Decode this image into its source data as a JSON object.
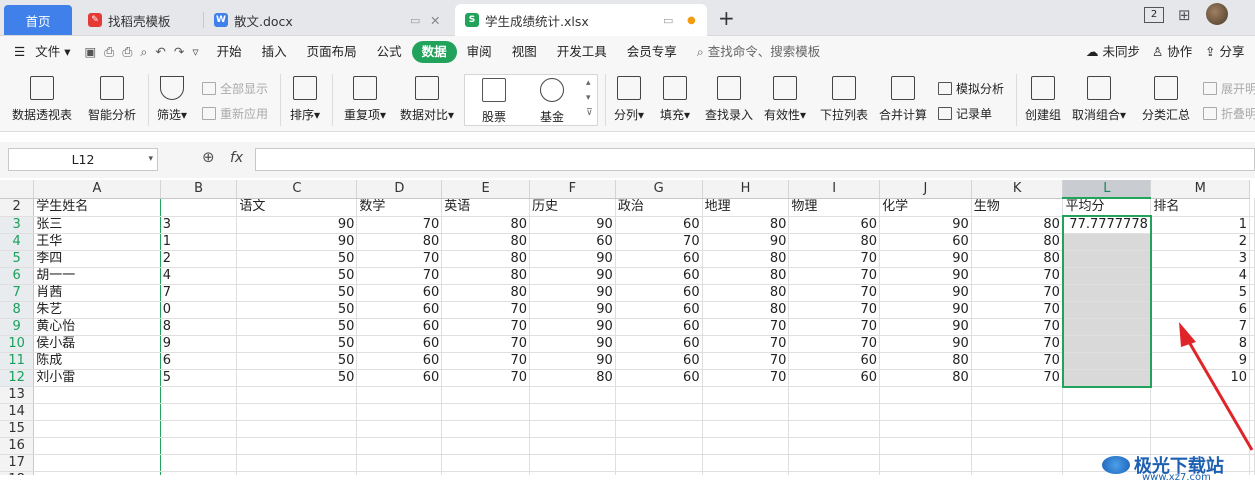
{
  "tabs": [
    {
      "label": "首页"
    },
    {
      "label": "找稻壳模板"
    },
    {
      "label": "散文.docx"
    },
    {
      "label": "学生成绩统计.xlsx"
    }
  ],
  "titlebar": {
    "new_tab": "+",
    "badge": "2"
  },
  "menu": {
    "file": "文件",
    "items": [
      "开始",
      "插入",
      "页面布局",
      "公式",
      "数据",
      "审阅",
      "视图",
      "开发工具",
      "会员专享"
    ],
    "active": "数据",
    "search": "查找命令、搜索模板",
    "sync": "未同步",
    "collab": "协作",
    "share": "分享"
  },
  "ribbon": {
    "pivot": "数据透视表",
    "smart": "智能分析",
    "filter": "筛选",
    "show_all": "全部显示",
    "reapply": "重新应用",
    "sort": "排序",
    "dup": "重复项",
    "compare": "数据对比",
    "stock": "股票",
    "fund": "基金",
    "split": "分列",
    "fill": "填充",
    "lookup": "查找录入",
    "validity": "有效性",
    "dropdown": "下拉列表",
    "consolidate": "合并计算",
    "simulate": "模拟分析",
    "record": "记录单",
    "group": "创建组",
    "ungroup": "取消组合",
    "subtotal": "分类汇总",
    "expand": "展开明",
    "collapse": "折叠明"
  },
  "formula": {
    "cell_ref": "L12",
    "fx": "fx",
    "zoom_icon": "zoom-icon",
    "value": ""
  },
  "grid": {
    "columns": [
      "A",
      "B",
      "C",
      "D",
      "E",
      "F",
      "G",
      "H",
      "I",
      "J",
      "K",
      "L",
      "M"
    ],
    "selected_column": "L",
    "rows": [
      {
        "n": "2",
        "cells": [
          "学生姓名",
          "",
          "语文",
          "数学",
          "英语",
          "历史",
          "政治",
          "地理",
          "物理",
          "化学",
          "生物",
          "平均分",
          "排名"
        ]
      },
      {
        "n": "3",
        "cells": [
          "张三",
          "3",
          "90",
          "70",
          "80",
          "90",
          "60",
          "80",
          "60",
          "90",
          "80",
          "77.7777778",
          "1"
        ]
      },
      {
        "n": "4",
        "cells": [
          "王华",
          "1",
          "90",
          "80",
          "80",
          "60",
          "70",
          "90",
          "80",
          "60",
          "80",
          "",
          "2"
        ]
      },
      {
        "n": "5",
        "cells": [
          "李四",
          "2",
          "50",
          "70",
          "80",
          "90",
          "60",
          "80",
          "70",
          "90",
          "80",
          "",
          "3"
        ]
      },
      {
        "n": "6",
        "cells": [
          "胡一一",
          "4",
          "50",
          "70",
          "80",
          "90",
          "60",
          "80",
          "70",
          "90",
          "70",
          "",
          "4"
        ]
      },
      {
        "n": "7",
        "cells": [
          "肖茜",
          "7",
          "50",
          "60",
          "80",
          "90",
          "60",
          "80",
          "70",
          "90",
          "70",
          "",
          "5"
        ]
      },
      {
        "n": "8",
        "cells": [
          "朱艺",
          "0",
          "50",
          "60",
          "70",
          "90",
          "60",
          "80",
          "70",
          "90",
          "70",
          "",
          "6"
        ]
      },
      {
        "n": "9",
        "cells": [
          "黄心怡",
          "8",
          "50",
          "60",
          "70",
          "90",
          "60",
          "70",
          "70",
          "90",
          "70",
          "",
          "7"
        ]
      },
      {
        "n": "10",
        "cells": [
          "侯小磊",
          "9",
          "50",
          "60",
          "70",
          "90",
          "60",
          "70",
          "70",
          "90",
          "70",
          "",
          "8"
        ]
      },
      {
        "n": "11",
        "cells": [
          "陈成",
          "6",
          "50",
          "60",
          "70",
          "90",
          "60",
          "70",
          "60",
          "80",
          "70",
          "",
          "9"
        ]
      },
      {
        "n": "12",
        "cells": [
          "刘小雷",
          "5",
          "50",
          "60",
          "70",
          "80",
          "60",
          "70",
          "60",
          "80",
          "70",
          "",
          "10"
        ]
      },
      {
        "n": "13",
        "cells": [
          "",
          "",
          "",
          "",
          "",
          "",
          "",
          "",
          "",
          "",
          "",
          "",
          ""
        ]
      },
      {
        "n": "14",
        "cells": [
          "",
          "",
          "",
          "",
          "",
          "",
          "",
          "",
          "",
          "",
          "",
          "",
          ""
        ]
      },
      {
        "n": "15",
        "cells": [
          "",
          "",
          "",
          "",
          "",
          "",
          "",
          "",
          "",
          "",
          "",
          "",
          ""
        ]
      },
      {
        "n": "16",
        "cells": [
          "",
          "",
          "",
          "",
          "",
          "",
          "",
          "",
          "",
          "",
          "",
          "",
          ""
        ]
      },
      {
        "n": "17",
        "cells": [
          "",
          "",
          "",
          "",
          "",
          "",
          "",
          "",
          "",
          "",
          "",
          "",
          ""
        ]
      },
      {
        "n": "18",
        "cells": [
          "",
          "",
          "",
          "",
          "",
          "",
          "",
          "",
          "",
          "",
          "",
          "",
          ""
        ]
      }
    ]
  },
  "watermark": {
    "text": "极光下载站",
    "url": "www.xz7.com"
  },
  "colors": {
    "accent": "#22a35c",
    "home_tab": "#3f80ea",
    "arrow": "#e0252a"
  }
}
